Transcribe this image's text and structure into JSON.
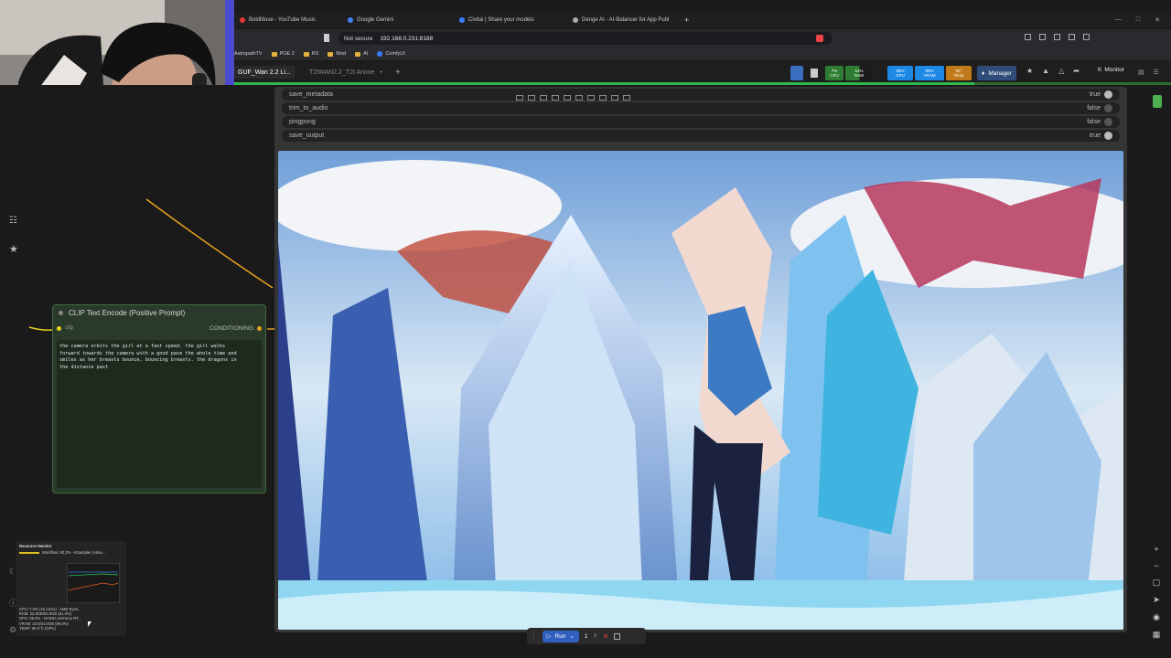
{
  "browser": {
    "tabs": [
      {
        "label": "BoldMove - YouTube Music",
        "color": "#e53935"
      },
      {
        "label": "Google Gemini",
        "color": "#4285f4"
      },
      {
        "label": "Civitai | Share your models",
        "color": "#3d7bff"
      },
      {
        "label": "Denge AI - AI-Balancer for App Publ",
        "color": "#aaaaaa"
      }
    ],
    "new_tab": "+",
    "security": "Not secure",
    "url": "192.168.0.231:8188",
    "bookmarks": [
      "AstropathTV",
      "POE 2",
      "RS",
      "Mod",
      "AI",
      "ComfyUI"
    ]
  },
  "comfy": {
    "workflow_tabs": [
      {
        "label": "GUF_Wan 2.2 Li..."
      },
      {
        "label": "T2IWAN2.2_T2I Anime"
      }
    ],
    "add_tab": "+",
    "meters": [
      {
        "label": "CPU",
        "value": "7%",
        "color": "#2e7d32"
      },
      {
        "label": "RAM",
        "value": "51%",
        "color": "#2e7d32"
      },
      {
        "label": "GPU",
        "value": "85%",
        "color": "#1e88e5"
      },
      {
        "label": "VRAM",
        "value": "99%",
        "color": "#1e88e5"
      },
      {
        "label": "Temp",
        "value": "65°",
        "color": "#c07a1a"
      }
    ],
    "manager_label": "Manager",
    "monitor_label": "Monitor",
    "progress": 0.79
  },
  "clip_node": {
    "title": "CLIP Text Encode (Positive Prompt)",
    "input_label": "clip",
    "output_label": "CONDITIONING",
    "prompt": "the camera orbits the girl at a fast speed. the girl walks\nforward towards the camera with a good pace the whole time and\nsmiles as her breasts bounce, bouncing breasts. the dragons in\nthe distance past"
  },
  "output_node": {
    "widgets": [
      {
        "name": "save_metadata",
        "value": "true"
      },
      {
        "name": "trim_to_audio",
        "value": "false"
      },
      {
        "name": "pingpong",
        "value": "false"
      },
      {
        "name": "save_output",
        "value": "true"
      }
    ]
  },
  "resource_monitor": {
    "title": "Resource Monitor",
    "workflow": "Workflow: 83.3% - KSampler (Adva...",
    "lines": [
      "CPU: 7.0% (16 cores) - AMD Ryze...",
      "RAM: 32.8GB/63.9GB (51.0%)",
      "GPU: 85.0% - NVIDIA GeForce RT...",
      "VRAM: 23.9/24.0GB (99.0%)",
      "TEMP: 65.0°C (GPU)"
    ]
  },
  "run_bar": {
    "run_label": "Run",
    "batch_count": "1"
  }
}
